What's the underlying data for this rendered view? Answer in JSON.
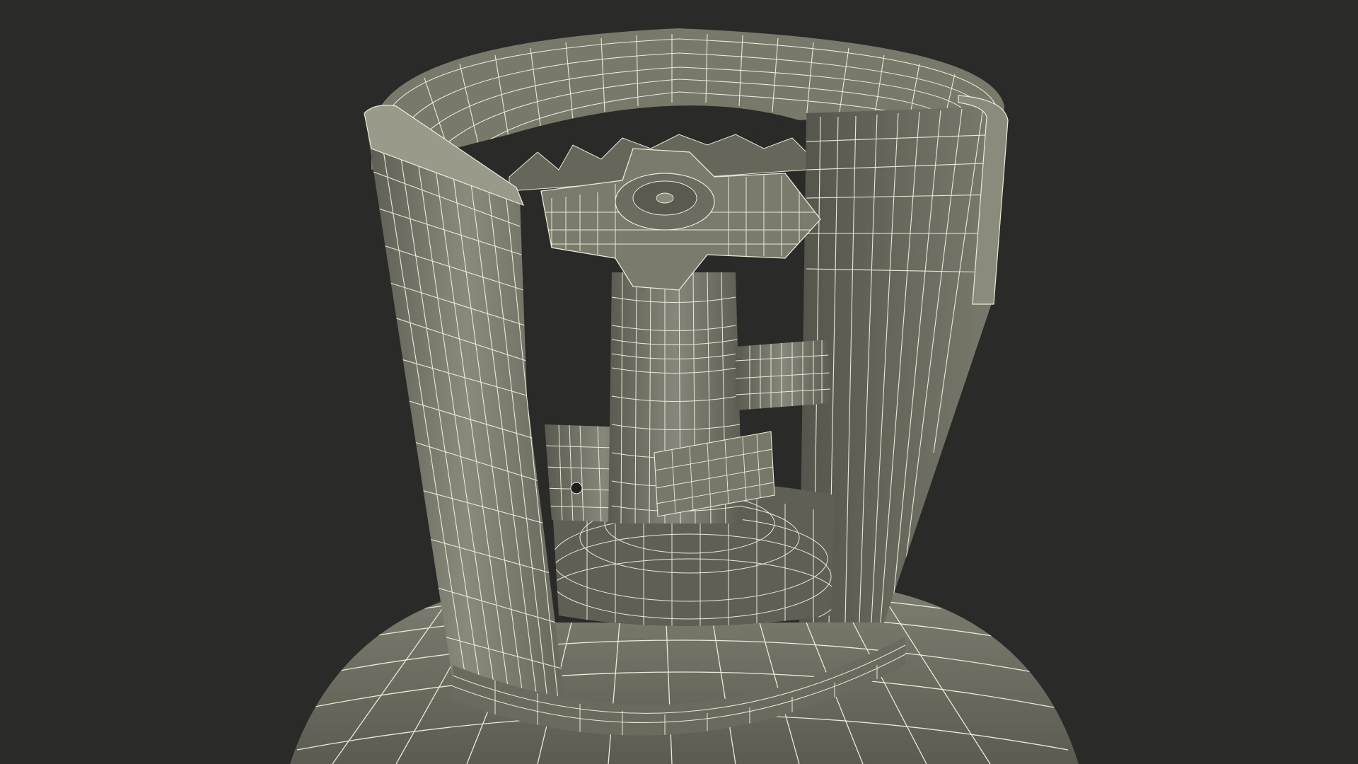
{
  "scene": {
    "background_color": "#2a2a29",
    "mesh_fill": "#6c6c60",
    "mesh_fill_light": "#8a8a7c",
    "mesh_fill_dark": "#4a4a42",
    "wire_color": "#ecead8"
  }
}
